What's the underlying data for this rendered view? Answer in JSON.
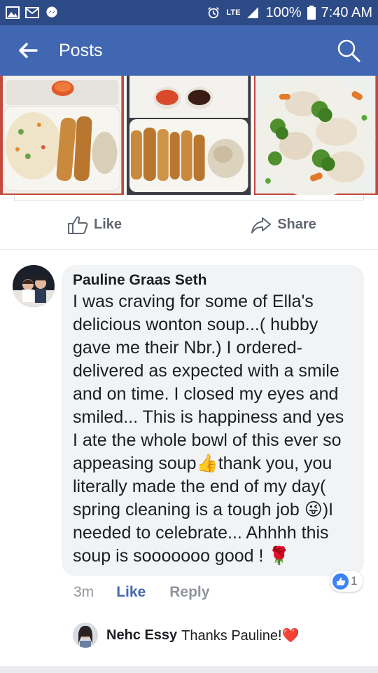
{
  "status_bar": {
    "network": "LTE",
    "battery": "100%",
    "time": "7:40 AM"
  },
  "app_bar": {
    "title": "Posts"
  },
  "actions": {
    "like_label": "Like",
    "share_label": "Share"
  },
  "comment": {
    "author": "Pauline Graas Seth",
    "text_1": "I was craving for some of Ella's delicious wonton soup...( hubby gave me their Nbr.) I ordered- delivered as expected with a smile and on time. I closed my eyes and smiled... This is happiness and yes I ate the whole bowl of this ever so appeasing soup",
    "emoji_thumb": "👍",
    "text_2": "thank you, you literally made the end of my day( spring cleaning is a tough job ",
    "emoji_wink": "😜",
    "text_3": ")I needed to celebrate...   Ahhhh this soup is sooooooo good ! ",
    "emoji_rose": "🌹",
    "time": "3m",
    "like_label": "Like",
    "reply_label": "Reply",
    "reaction_count": "1"
  },
  "reply": {
    "author": "Nehc Essy",
    "text": "Thanks Pauline!",
    "emoji": "❤️"
  },
  "colors": {
    "status_bar": "#2c4a86",
    "app_bar": "#4267b2",
    "link_blue": "#4267b2",
    "bubble": "#f2f3f5"
  }
}
